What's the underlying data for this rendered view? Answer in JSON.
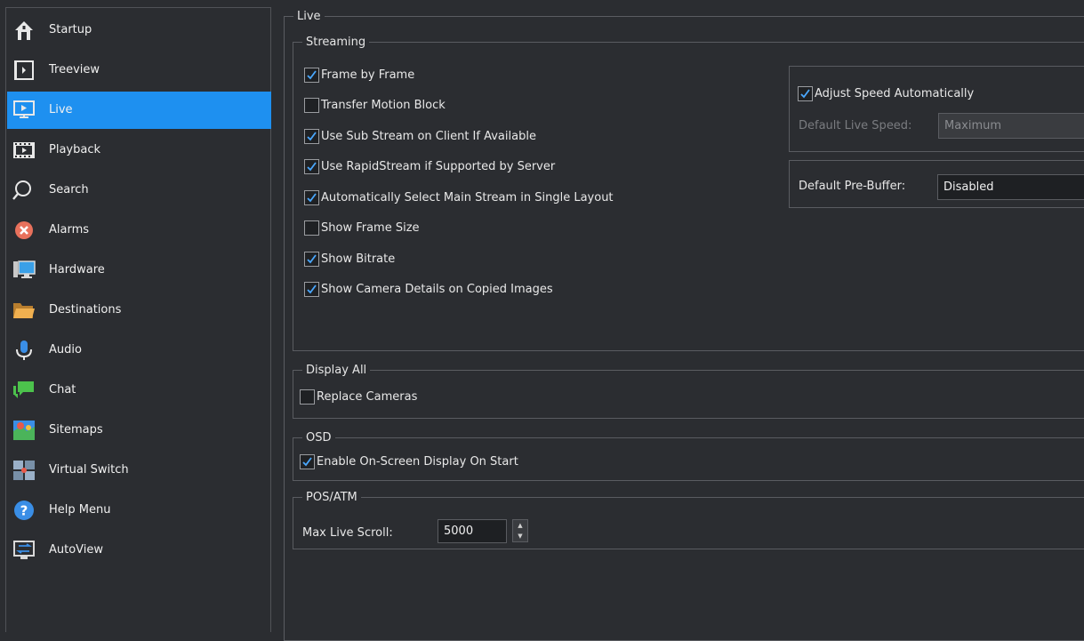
{
  "sidebar": {
    "items": [
      {
        "label": "Startup",
        "icon": "home-icon"
      },
      {
        "label": "Treeview",
        "icon": "treeview-icon"
      },
      {
        "label": "Live",
        "icon": "monitor-play-icon",
        "active": true
      },
      {
        "label": "Playback",
        "icon": "film-icon"
      },
      {
        "label": "Search",
        "icon": "search-icon"
      },
      {
        "label": "Alarms",
        "icon": "alarm-x-icon"
      },
      {
        "label": "Hardware",
        "icon": "computer-icon"
      },
      {
        "label": "Destinations",
        "icon": "folder-icon"
      },
      {
        "label": "Audio",
        "icon": "microphone-icon"
      },
      {
        "label": "Chat",
        "icon": "chat-icon"
      },
      {
        "label": "Sitemaps",
        "icon": "map-icon"
      },
      {
        "label": "Virtual Switch",
        "icon": "virtual-switch-icon"
      },
      {
        "label": "Help Menu",
        "icon": "help-icon"
      },
      {
        "label": "AutoView",
        "icon": "autoview-icon"
      }
    ],
    "active_color": "#1e90f0"
  },
  "live": {
    "title": "Live",
    "streaming": {
      "title": "Streaming",
      "options": [
        {
          "label": "Frame by Frame",
          "checked": true
        },
        {
          "label": "Transfer Motion Block",
          "checked": false
        },
        {
          "label": "Use Sub Stream on Client If Available",
          "checked": true
        },
        {
          "label": "Use RapidStream if Supported by Server",
          "checked": true
        },
        {
          "label": "Automatically Select Main Stream in Single Layout",
          "checked": true
        },
        {
          "label": "Show Frame Size",
          "checked": false
        },
        {
          "label": "Show Bitrate",
          "checked": true
        },
        {
          "label": "Show Camera Details on Copied Images",
          "checked": true
        }
      ],
      "adjust_speed": {
        "label": "Adjust Speed Automatically",
        "checked": true
      },
      "default_live_speed": {
        "label": "Default Live Speed:",
        "value": "Maximum"
      },
      "default_pre_buffer": {
        "label": "Default Pre-Buffer:",
        "value": "Disabled"
      }
    },
    "display_all": {
      "title": "Display All",
      "replace_cameras": {
        "label": "Replace Cameras",
        "checked": false
      }
    },
    "osd": {
      "title": "OSD",
      "enable_osd": {
        "label": "Enable On-Screen Display On Start",
        "checked": true
      }
    },
    "pos_atm": {
      "title": "POS/ATM",
      "max_live_scroll": {
        "label": "Max Live Scroll:",
        "value": "5000"
      }
    }
  }
}
